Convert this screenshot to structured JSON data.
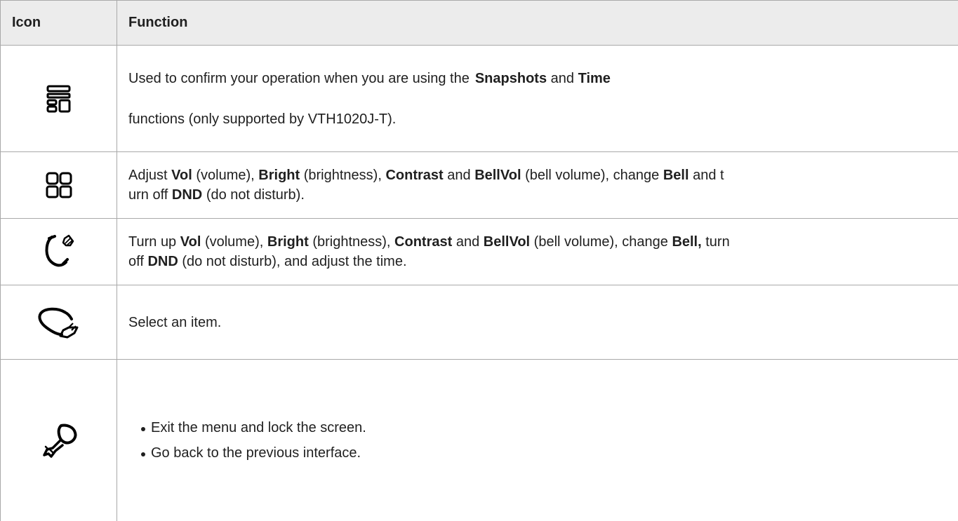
{
  "table": {
    "headers": {
      "icon": "Icon",
      "function": "Function"
    },
    "rows": [
      {
        "icon": "menu-layout-icon",
        "parts": [
          "Used to confirm your operation when you are using the",
          "Snapshots",
          "and",
          "Time",
          "functions (only supported by VTH1020J-T)."
        ]
      },
      {
        "icon": "four-squares-icon",
        "parts": [
          "Adjust",
          "Vol",
          "(volume),",
          "Bright",
          "(brightness),",
          "Contrast",
          "and",
          "BellVol",
          "(bell volume), change",
          "Bell",
          "and t",
          "urn off",
          "DND",
          "(do not disturb)."
        ]
      },
      {
        "icon": "handset-bell-icon",
        "parts": [
          "Turn up",
          "Vol",
          "(volume),",
          "Bright",
          "(brightness),",
          "Contrast",
          "and",
          "BellVol",
          "(bell volume), change",
          "Bell,",
          "turn",
          "off",
          "DND",
          "(do not disturb), and adjust the time."
        ]
      },
      {
        "icon": "handset-hook-icon",
        "text": "Select an item."
      },
      {
        "icon": "back-key-icon",
        "bullets": [
          "Exit the menu and lock the screen.",
          "Go back to the previous interface."
        ]
      }
    ]
  }
}
